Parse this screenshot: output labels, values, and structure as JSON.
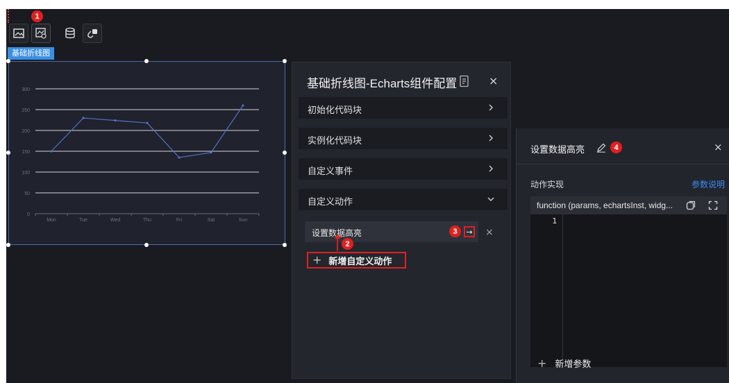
{
  "toolbar": {
    "icons": [
      "image-icon",
      "chart-settings-icon",
      "database-icon",
      "link-icon"
    ],
    "badge": "1"
  },
  "widget": {
    "tag": "基础折线图"
  },
  "chart_data": {
    "type": "line",
    "categories": [
      "Mon",
      "Tue",
      "Wed",
      "Thu",
      "Fri",
      "Sat",
      "Sun"
    ],
    "values": [
      150,
      230,
      224,
      218,
      135,
      147,
      260
    ],
    "yticks": [
      "0",
      "50",
      "100",
      "150",
      "200",
      "250",
      "300"
    ],
    "ylim": [
      0,
      300
    ],
    "grid": true,
    "line_color": "#5470c6"
  },
  "config_panel": {
    "title": "基础折线图-Echarts组件配置",
    "close": "×",
    "sections": [
      {
        "label": "初始化代码块",
        "chevron": "right"
      },
      {
        "label": "实例化代码块",
        "chevron": "right"
      },
      {
        "label": "自定义事件",
        "chevron": "right"
      },
      {
        "label": "自定义动作",
        "chevron": "down"
      }
    ],
    "action_item": "设置数据高亮",
    "goto_symbol": "→",
    "delete_symbol": "×",
    "add_action": "新增自定义动作",
    "add_symbol": "+",
    "badges": {
      "b2": "2",
      "b3": "3"
    }
  },
  "action_panel": {
    "title": "设置数据高亮",
    "badge": "4",
    "close": "×",
    "impl_label": "动作实现",
    "param_doc_link": "参数说明",
    "signature": "function (params, echartsInst, widg...",
    "line_number": "1",
    "add_param": "新增参数",
    "add_symbol": "+"
  },
  "colors": {
    "accent": "#3b8fe0",
    "badge": "#e02020",
    "link": "#3d8bef"
  }
}
